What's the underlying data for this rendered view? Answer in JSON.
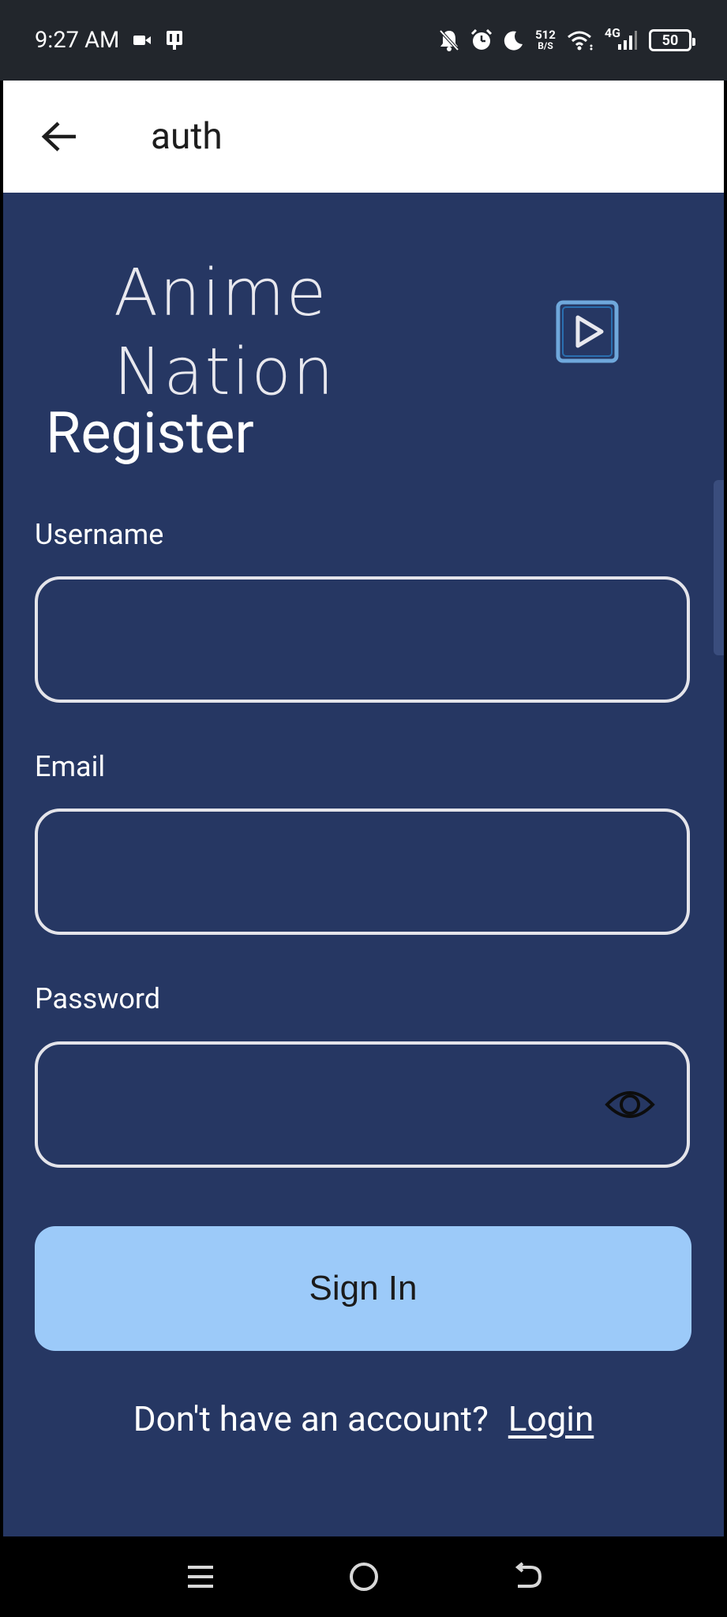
{
  "status_bar": {
    "time": "9:27 AM",
    "net_speed_value": "512",
    "net_speed_unit": "B/S",
    "network_type": "4G",
    "battery": "50"
  },
  "app_bar": {
    "title": "auth"
  },
  "brand": {
    "logo_text": "Anime Nation"
  },
  "form": {
    "heading": "Register",
    "username_label": "Username",
    "username_value": "",
    "email_label": "Email",
    "email_value": "",
    "password_label": "Password",
    "password_value": "",
    "submit_label": "Sign In"
  },
  "switch": {
    "prompt": "Don't have an account?",
    "link_label": "Login"
  },
  "colors": {
    "background": "#263763",
    "button": "#9ccaf9",
    "field_border": "#e4e4ea",
    "status_bar": "#22262c"
  }
}
